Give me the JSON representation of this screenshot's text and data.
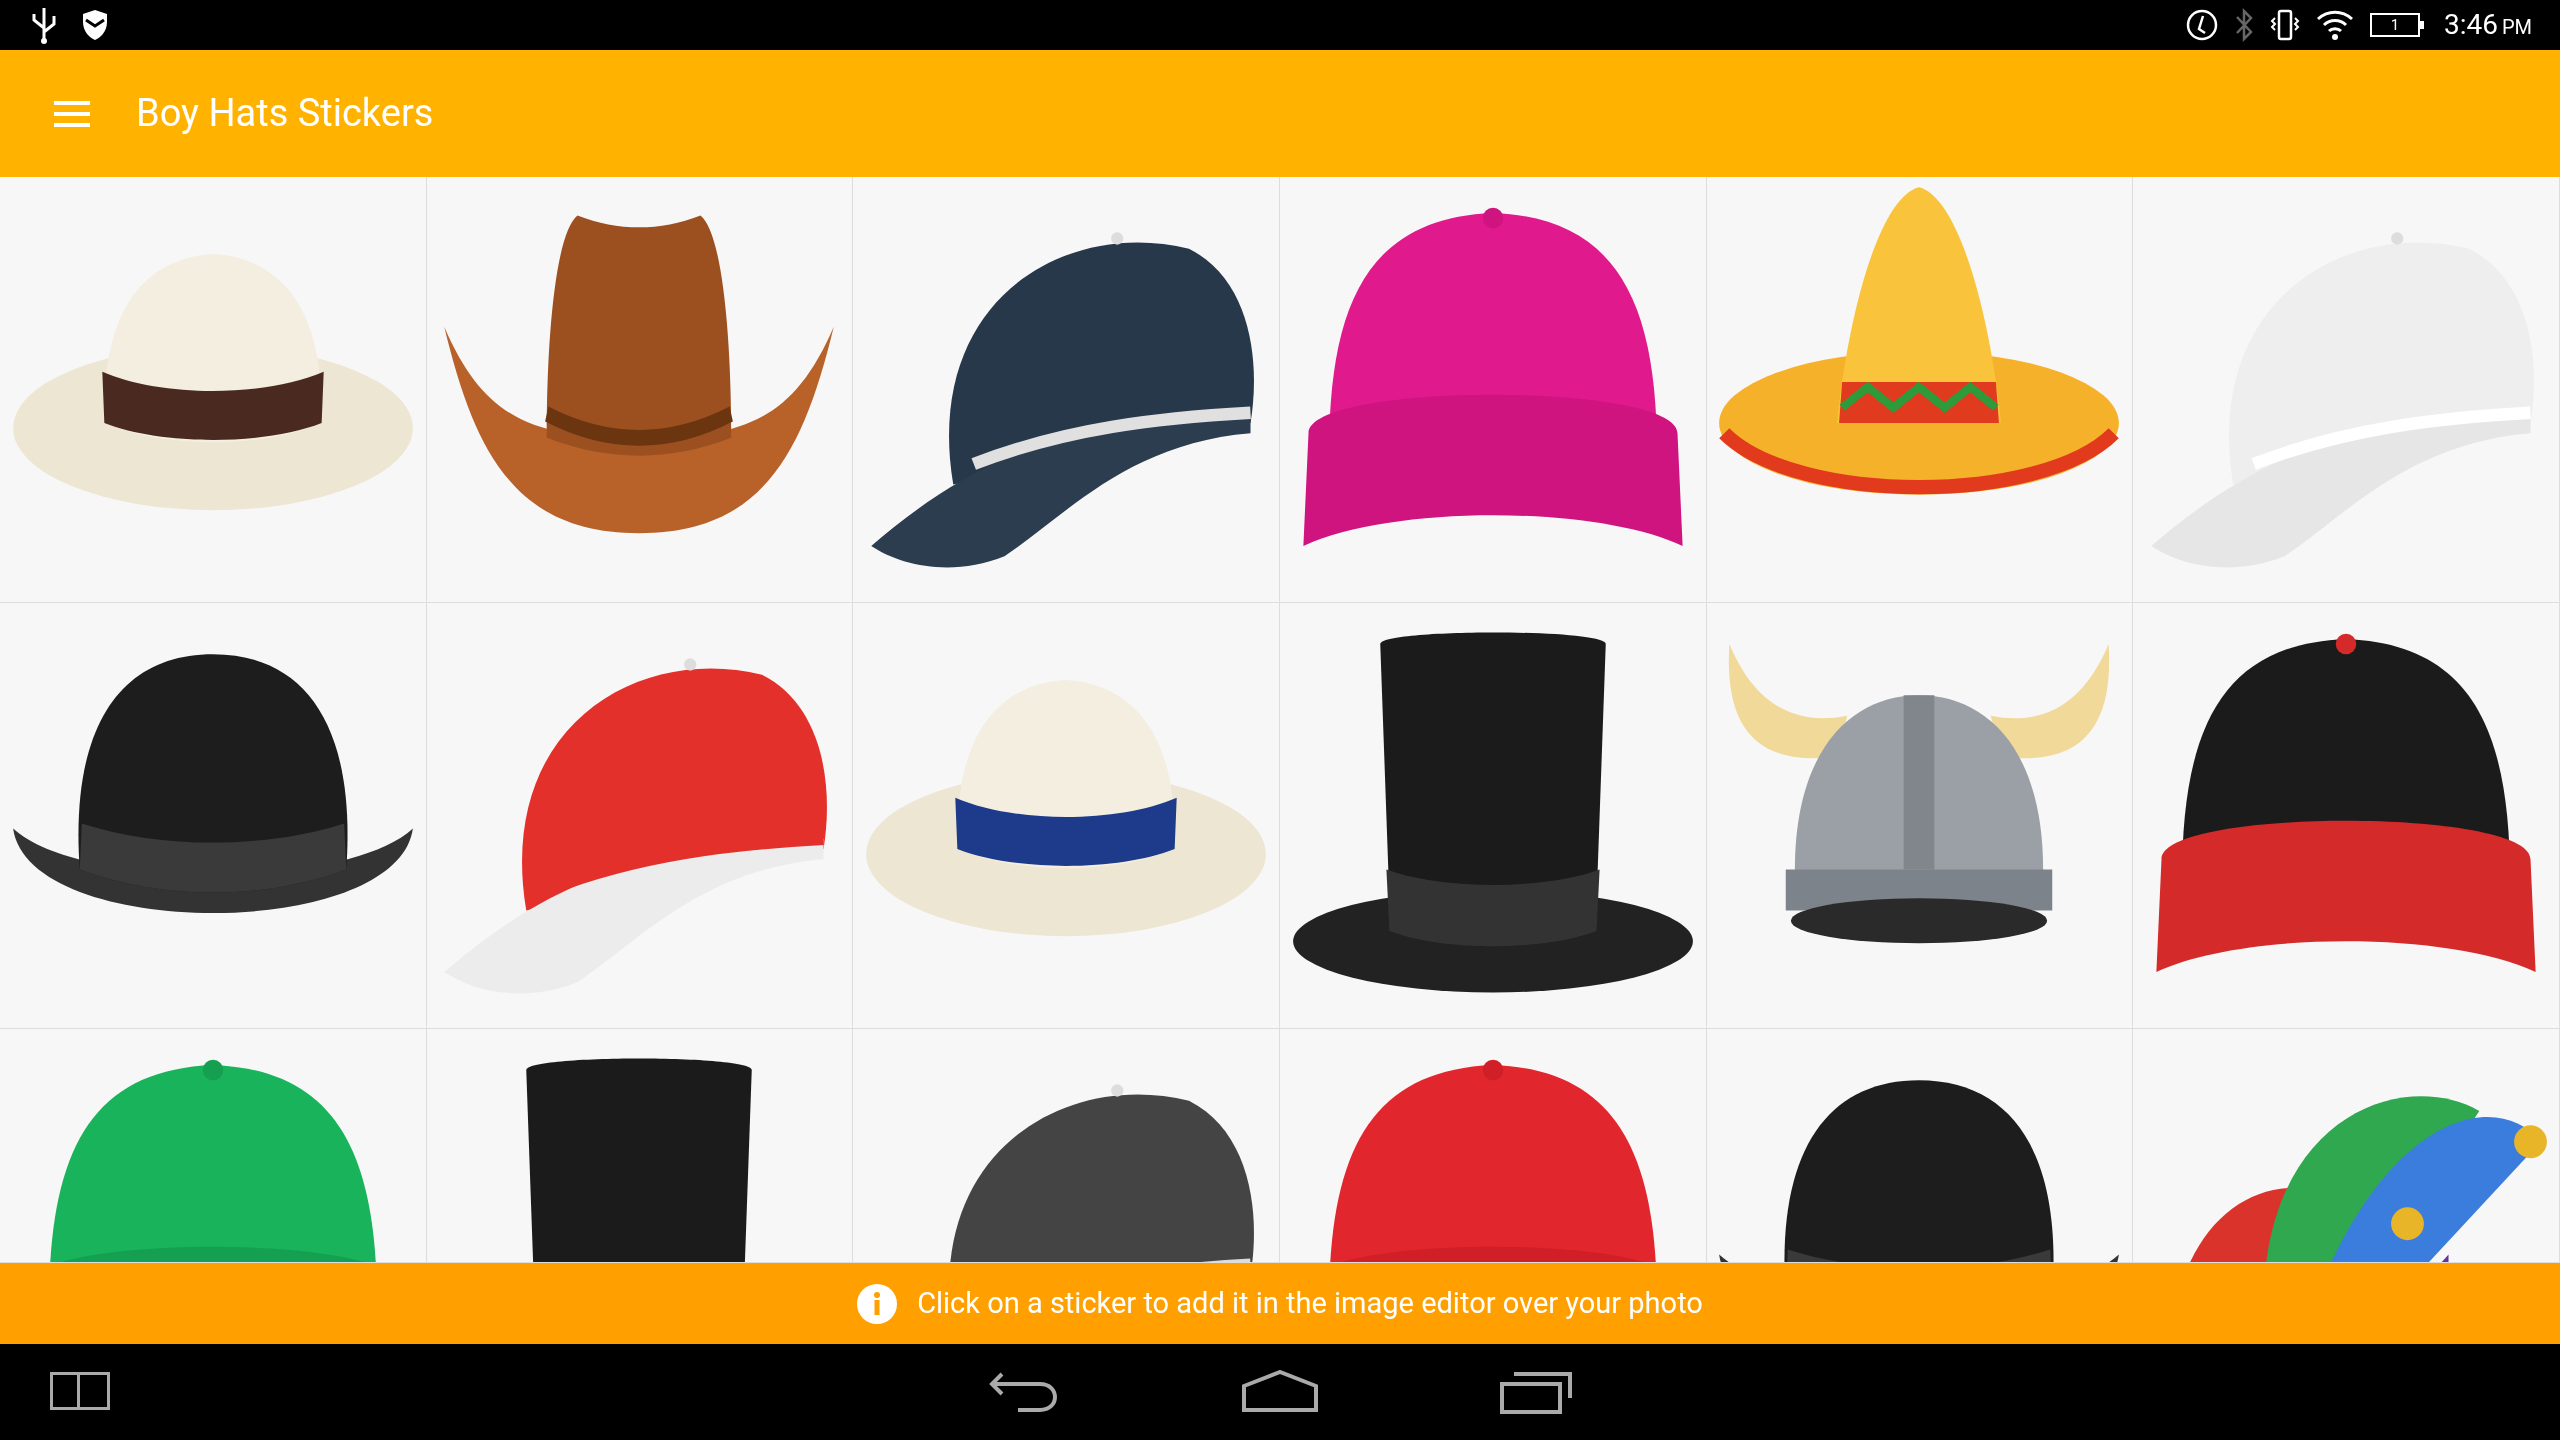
{
  "status_bar": {
    "battery_level_text": "1",
    "time": "3:46",
    "time_suffix": "PM"
  },
  "app_bar": {
    "title": "Boy Hats Stickers"
  },
  "info_banner": {
    "text": "Click on a sticker to add it in the image editor over your photo"
  }
}
